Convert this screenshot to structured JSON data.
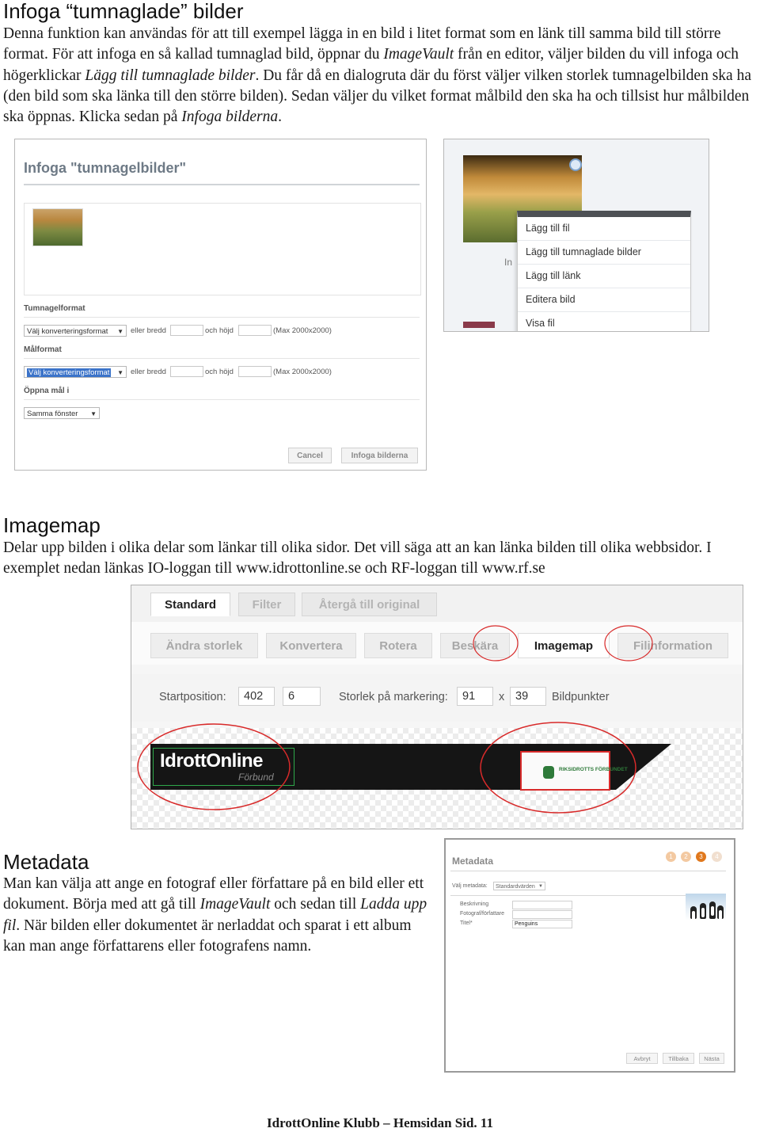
{
  "sections": {
    "tumnaglade": {
      "heading": "Infoga “tumnaglade” bilder",
      "body": {
        "p1": "Denna funktion kan användas för att till exempel lägga in en bild i litet format som en länk till samma bild till större format. För att infoga en så kallad tumnaglad bild, öppnar du ",
        "em1": "ImageVault",
        "p2": " från en editor, väljer bilden du vill infoga och högerklickar ",
        "em2": "Lägg till tumnaglade bilder",
        "p3": ". Du får då en dialogruta där du först väljer vilken storlek tumnagelbilden ska ha (den bild som ska länka till den större bilden). Sedan väljer du vilket format målbild den ska ha och tillsist hur målbilden ska öppnas. Klicka sedan på ",
        "em3": "Infoga bilderna",
        "p4": "."
      }
    },
    "imagemap": {
      "heading": "Imagemap",
      "body": "Delar upp bilden i olika delar som länkar till olika sidor. Det vill säga att an kan länka bilden till olika webbsidor. I exemplet nedan länkas IO-loggan till www.idrottonline.se och RF-loggan till www.rf.se"
    },
    "metadata": {
      "heading": "Metadata",
      "body": {
        "p1": "Man kan välja att ange en fotograf eller författare på en bild eller ett dokument. Börja med att gå till ",
        "em1": "ImageVault",
        "p2": " och sedan till ",
        "em2": "Ladda upp fil",
        "p3": ". När bilden eller dokumentet är nerladdat och sparat i ett album kan man ange författarens eller fotografens namn."
      }
    }
  },
  "infoga_dialog": {
    "title": "Infoga \"tumnagelbilder\"",
    "tumnagelformat_label": "Tumnagelformat",
    "malformat_label": "Målformat",
    "oppna_label": "Öppna mål i",
    "select_format": "Välj konverteringsformat",
    "eller_bredd": "eller bredd",
    "och_hojd": "och höjd",
    "max_note": "(Max 2000x2000)",
    "window_select": "Samma fönster",
    "cancel": "Cancel",
    "insert": "Infoga bilderna"
  },
  "context_menu": {
    "edge_text": "In",
    "items": [
      "Lägg till fil",
      "Lägg till tumnaglade bilder",
      "Lägg till länk",
      "Editera bild",
      "Visa fil"
    ]
  },
  "imagemap_editor": {
    "tabs": [
      "Standard",
      "Filter",
      "Återgå till original"
    ],
    "tools": [
      "Ändra storlek",
      "Konvertera",
      "Rotera",
      "Beskära",
      "Imagemap",
      "Filinformation"
    ],
    "startposition_label": "Startposition:",
    "start_x": "402",
    "start_y": "6",
    "size_label": "Storlek på markering:",
    "size_w": "91",
    "size_x": "x",
    "size_h": "39",
    "unit": "Bildpunkter",
    "io_logo": "IdrottOnline",
    "io_sub": "Förbund",
    "rf_logo": "RIKSIDROTTS FÖRBUNDET"
  },
  "metadata_dialog": {
    "title": "Metadata",
    "steps": [
      "1",
      "2",
      "3",
      "4"
    ],
    "select_label": "Välj metadata:",
    "select_value": "Standardvärden",
    "field_beskrivning": "Beskrivning",
    "field_fotograf": "Fotograf/författare",
    "field_titel": "Titel*",
    "titel_value": "Penguins",
    "back": "Avbryt",
    "prev": "Tillbaka",
    "next": "Nästa"
  },
  "footer": "IdrottOnline Klubb – Hemsidan Sid. 11",
  "colors": {
    "accent_orange": "#e0781d",
    "highlight_blue": "#3b73c9",
    "annotation_red": "#d82a2a",
    "mapped_green": "#2ea84a"
  }
}
